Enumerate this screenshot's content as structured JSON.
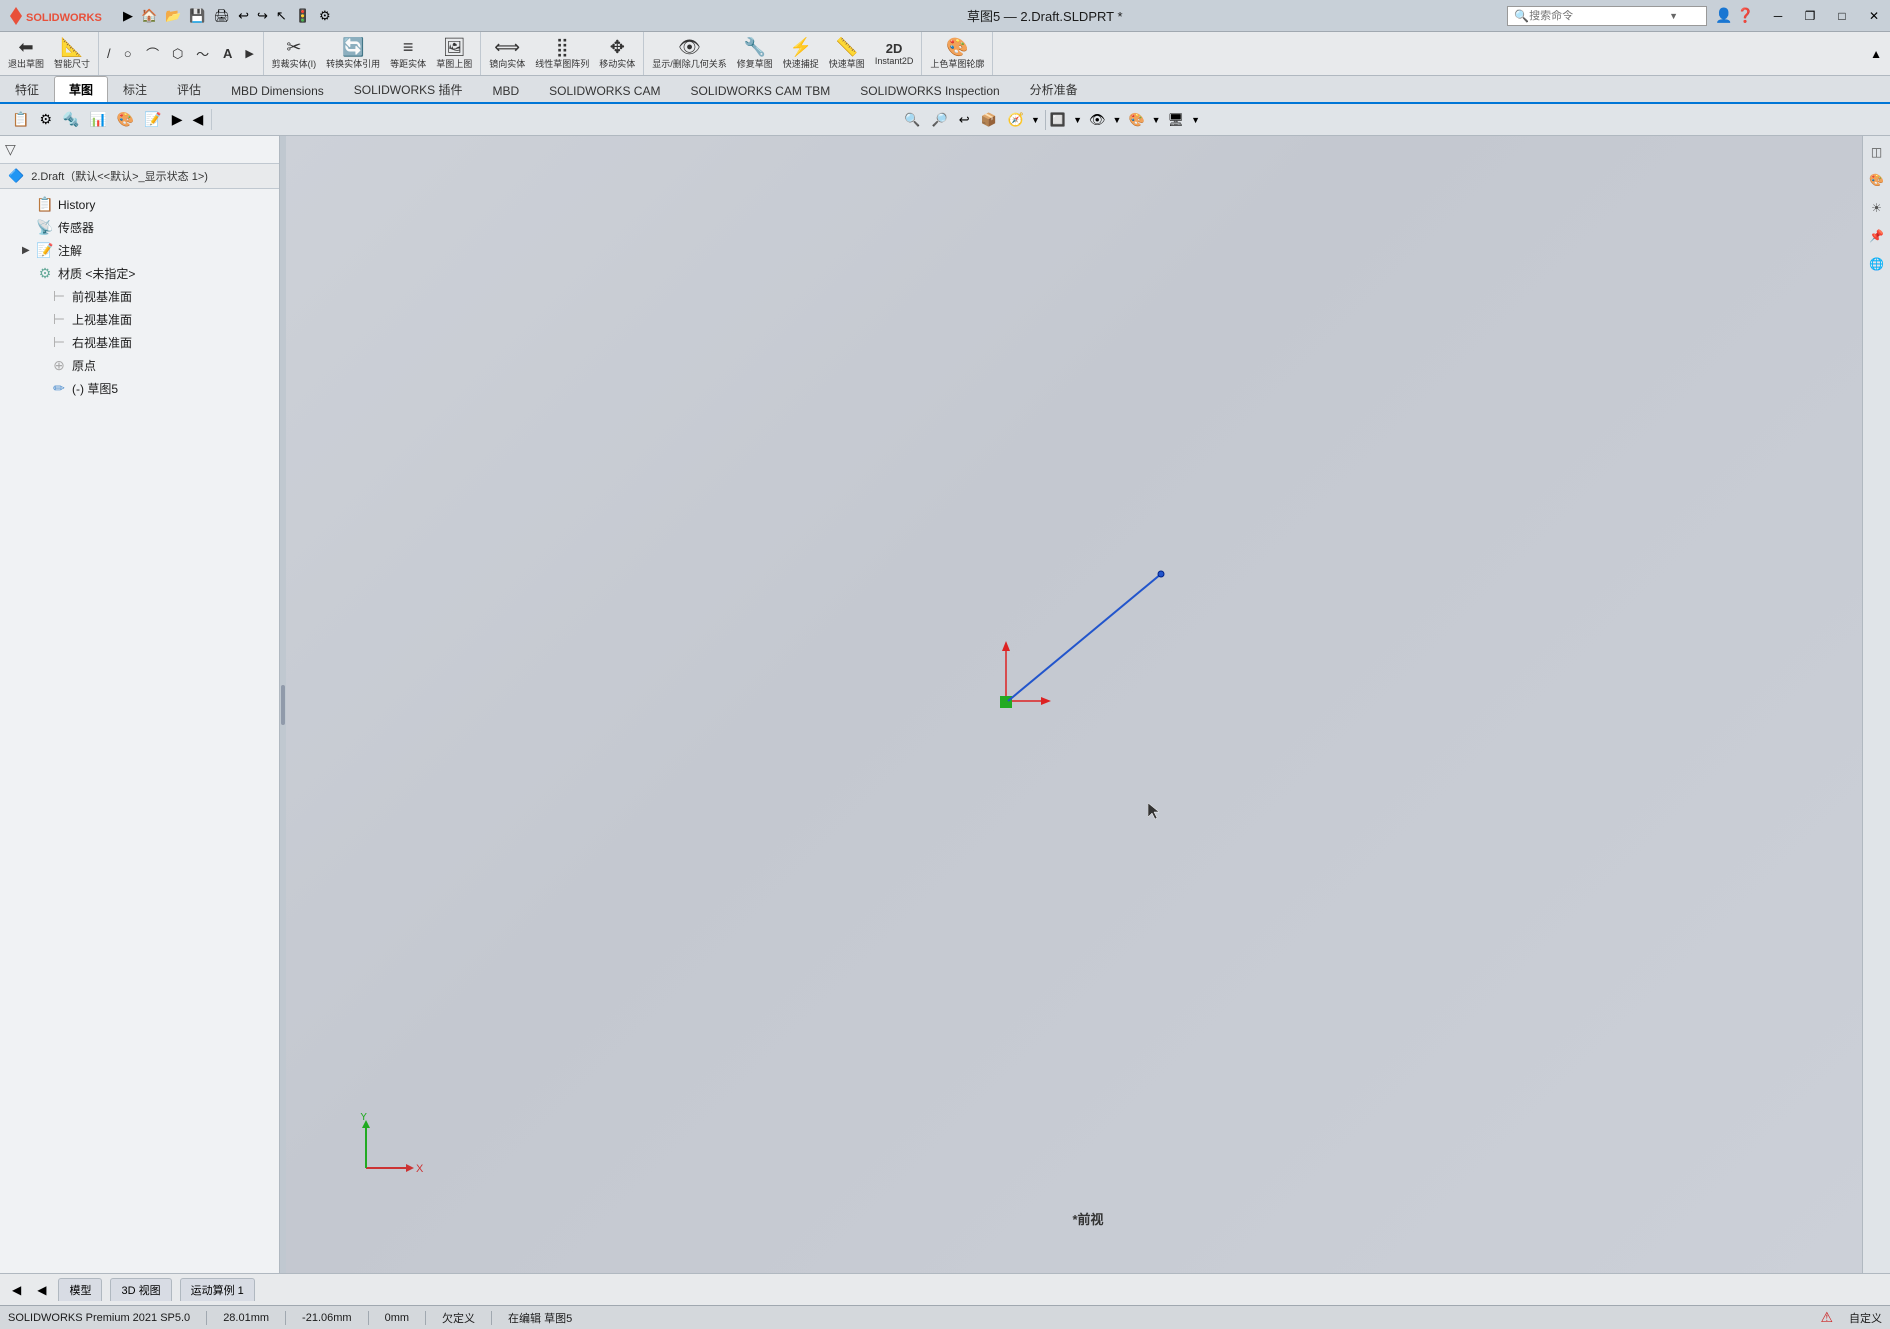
{
  "titlebar": {
    "title": "草图5 — 2.Draft.SLDPRT *",
    "search_placeholder": "搜索命令",
    "minimize_label": "─",
    "maximize_label": "□",
    "restore_label": "❐",
    "close_label": "✕"
  },
  "toolbar": {
    "groups": [
      {
        "buttons": [
          {
            "icon": "⬅",
            "label": "退出草图"
          },
          {
            "icon": "📐",
            "label": "智能尺寸"
          }
        ]
      },
      {
        "buttons": [
          {
            "icon": "∙",
            "label": ""
          },
          {
            "icon": "⌒",
            "label": ""
          },
          {
            "icon": "○",
            "label": ""
          },
          {
            "icon": "◇",
            "label": ""
          },
          {
            "icon": "A",
            "label": ""
          },
          {
            "icon": "⋯",
            "label": ""
          }
        ]
      },
      {
        "buttons": [
          {
            "icon": "✂",
            "label": "剪裁实体(I)"
          },
          {
            "icon": "🔄",
            "label": "转换实体引用"
          },
          {
            "icon": "≡",
            "label": "等距实体"
          },
          {
            "icon": "□",
            "label": "草图上图"
          }
        ]
      },
      {
        "buttons": [
          {
            "icon": "⟺",
            "label": "镜向实体"
          },
          {
            "icon": "≋",
            "label": "线性草图阵列"
          },
          {
            "icon": "↗",
            "label": "移动实体"
          }
        ]
      },
      {
        "buttons": [
          {
            "icon": "👁",
            "label": "显示/删除几何关系"
          },
          {
            "icon": "🔧",
            "label": "修复草图"
          },
          {
            "icon": "⚡",
            "label": "快速捕捉"
          },
          {
            "icon": "📏",
            "label": "快速草图"
          },
          {
            "icon": "2D",
            "label": "Instant2D"
          }
        ]
      },
      {
        "buttons": [
          {
            "icon": "🎨",
            "label": "上色草图轮廓"
          }
        ]
      }
    ]
  },
  "tabs": {
    "items": [
      {
        "label": "特征",
        "active": false
      },
      {
        "label": "草图",
        "active": true
      },
      {
        "label": "标注",
        "active": false
      },
      {
        "label": "评估",
        "active": false
      },
      {
        "label": "MBD Dimensions",
        "active": false
      },
      {
        "label": "SOLIDWORKS 插件",
        "active": false
      },
      {
        "label": "MBD",
        "active": false
      },
      {
        "label": "SOLIDWORKS CAM",
        "active": false
      },
      {
        "label": "SOLIDWORKS CAM TBM",
        "active": false
      },
      {
        "label": "SOLIDWORKS Inspection",
        "active": false
      },
      {
        "label": "分析准备",
        "active": false
      }
    ]
  },
  "tree": {
    "header": "2.Draft（默认<<默认>_显示状态 1>)",
    "items": [
      {
        "icon": "📋",
        "label": "History",
        "indent": 1,
        "expand": ""
      },
      {
        "icon": "📡",
        "label": "传感器",
        "indent": 1,
        "expand": ""
      },
      {
        "icon": "📝",
        "label": "注解",
        "indent": 1,
        "expand": "▶"
      },
      {
        "icon": "🔧",
        "label": "材质 <未指定>",
        "indent": 1,
        "expand": ""
      },
      {
        "icon": "⊢",
        "label": "前视基准面",
        "indent": 2,
        "expand": ""
      },
      {
        "icon": "⊢",
        "label": "上视基准面",
        "indent": 2,
        "expand": ""
      },
      {
        "icon": "⊢",
        "label": "右视基准面",
        "indent": 2,
        "expand": ""
      },
      {
        "icon": "⊕",
        "label": "原点",
        "indent": 2,
        "expand": ""
      },
      {
        "icon": "✏",
        "label": "(-) 草图5",
        "indent": 2,
        "expand": ""
      }
    ]
  },
  "sketch_view_toolbar": {
    "buttons": [
      "🔍",
      "🔎",
      "🔭",
      "📦",
      "📐",
      "🔲",
      "📊",
      "👁",
      "🎨",
      "🖥"
    ]
  },
  "bottom_tabs": [
    {
      "label": "模型",
      "active": false
    },
    {
      "label": "3D 视图",
      "active": false
    },
    {
      "label": "运动算例 1",
      "active": false
    }
  ],
  "statusbar": {
    "software": "SOLIDWORKS Premium 2021 SP5.0",
    "x_coord": "28.01mm",
    "y_coord": "-21.06mm",
    "z_coord": "0mm",
    "status": "欠定义",
    "mode": "在编辑 草图5",
    "custom": "自定义"
  },
  "view_label": "*前视",
  "canvas": {
    "background_color": "#d0d4dc"
  }
}
